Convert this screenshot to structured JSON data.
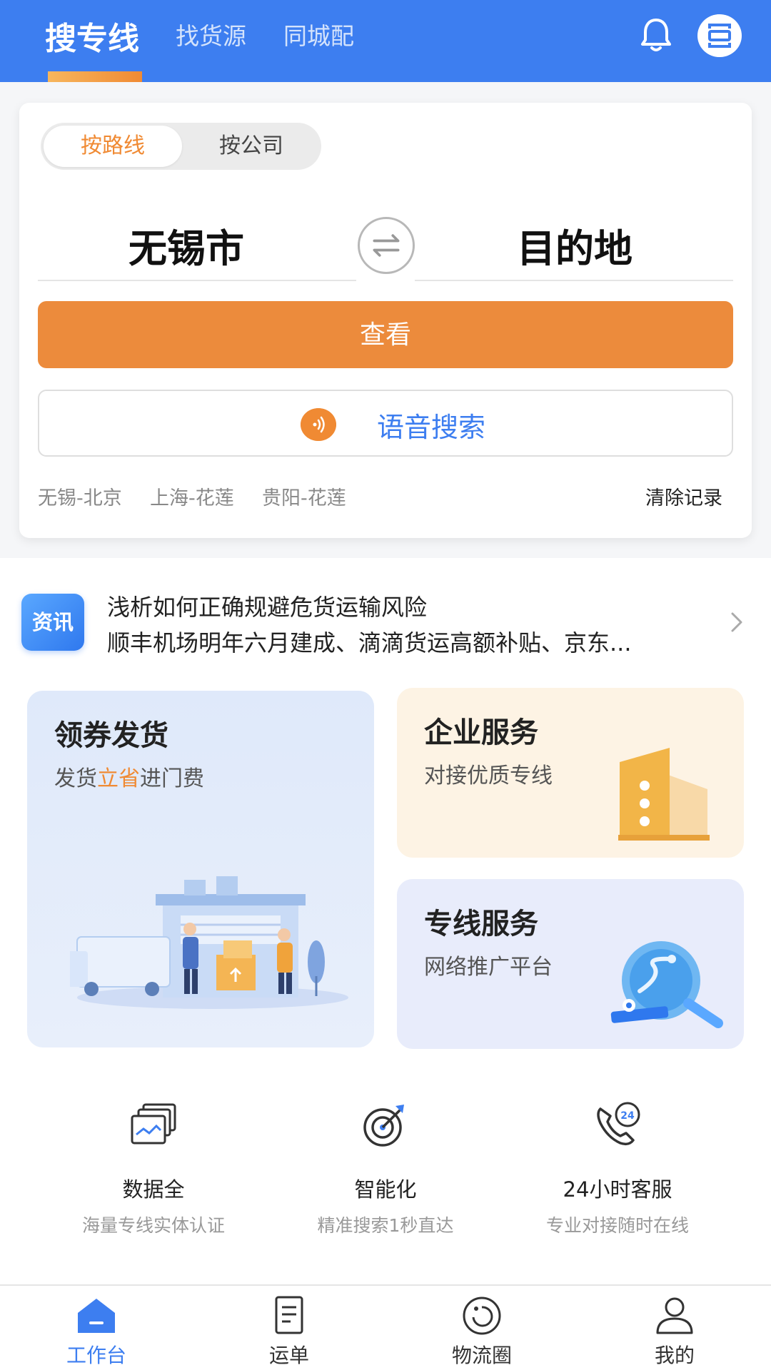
{
  "header": {
    "tabs": [
      {
        "label": "搜专线",
        "active": true
      },
      {
        "label": "找货源",
        "active": false
      },
      {
        "label": "同城配",
        "active": false
      }
    ],
    "icons": [
      "bell-icon",
      "scan-icon"
    ]
  },
  "search": {
    "mode_tabs": [
      "按路线",
      "按公司"
    ],
    "origin": "无锡市",
    "destination": "目的地",
    "query_label": "查看",
    "voice_label": "语音搜索",
    "history": [
      "无锡-北京",
      "上海-花莲",
      "贵阳-花莲"
    ],
    "clear_label": "清除记录"
  },
  "news": {
    "badge": "资讯",
    "line1": "浅析如何正确规避危货运输风险",
    "line2": "顺丰机场明年六月建成、滴滴货运高额补贴、京东..."
  },
  "tiles": {
    "coupon": {
      "title": "领券发货",
      "sub_pre": "发货",
      "sub_hl": "立省",
      "sub_post": "进门费"
    },
    "enterprise": {
      "title": "企业服务",
      "sub": "对接优质专线"
    },
    "line_service": {
      "title": "专线服务",
      "sub": "网络推广平台"
    }
  },
  "features": [
    {
      "title": "数据全",
      "sub": "海量专线实体认证",
      "icon": "data-cards-icon"
    },
    {
      "title": "智能化",
      "sub": "精准搜索1秒直达",
      "icon": "target-icon"
    },
    {
      "title": "24小时客服",
      "sub": "专业对接随时在线",
      "icon": "phone-24-icon"
    }
  ],
  "nav": [
    {
      "label": "工作台",
      "active": true,
      "icon": "home-icon"
    },
    {
      "label": "运单",
      "active": false,
      "icon": "document-icon"
    },
    {
      "label": "物流圈",
      "active": false,
      "icon": "circle-icon"
    },
    {
      "label": "我的",
      "active": false,
      "icon": "user-icon"
    }
  ],
  "colors": {
    "brand_blue": "#3d7ef0",
    "accent_orange": "#ec8b3c"
  }
}
